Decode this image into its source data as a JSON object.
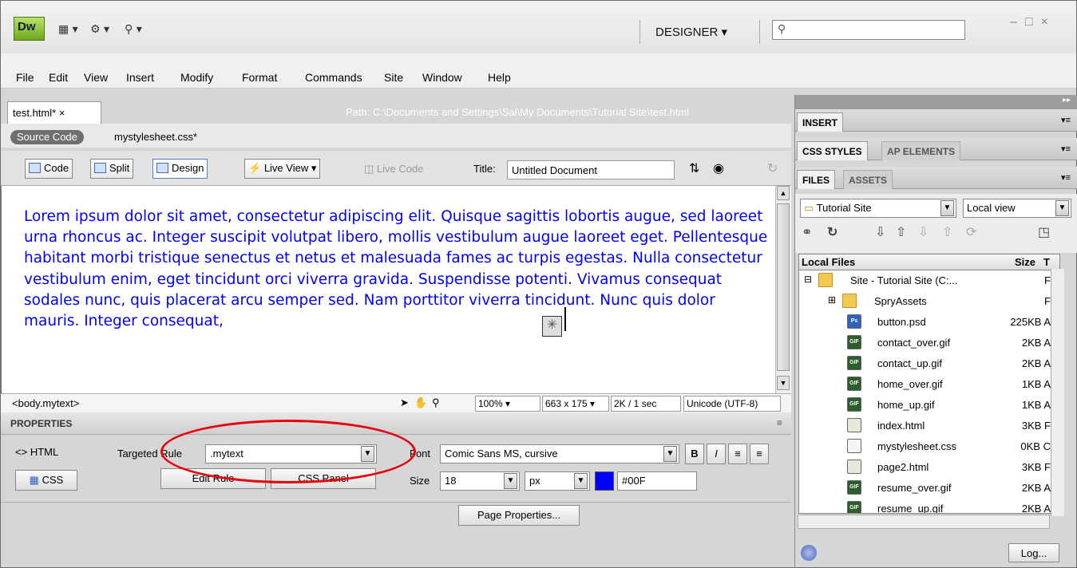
{
  "titlebar": {
    "logo": "Dw",
    "workspace": "DESIGNER",
    "search_placeholder": "",
    "icons": [
      "layout-icon",
      "gear-icon",
      "site-icon",
      "search-icon",
      "minimize-icon",
      "maximize-icon",
      "close-icon"
    ]
  },
  "menu": [
    "File",
    "Edit",
    "View",
    "Insert",
    "Modify",
    "Format",
    "Commands",
    "Site",
    "Window",
    "Help"
  ],
  "document": {
    "tab": "test.html*",
    "tab_close": "×",
    "path": "Path:  C:\\Documents and Settings\\Sal\\My Documents\\Tutorial Site\\test.html",
    "source_code": "Source Code",
    "related_file": "mystylesheet.css*",
    "view_buttons": [
      "Code",
      "Split",
      "Design"
    ],
    "live_view": "Live View",
    "live_code": "Live Code",
    "title_label": "Title:",
    "title_value": "Untitled Document",
    "body_text": "Lorem ipsum dolor sit amet, consectetur adipiscing elit. Quisque sagittis lobortis augue, sed laoreet urna rhoncus ac. Integer suscipit volutpat libero, mollis vestibulum augue laoreet eget. Pellentesque habitant morbi tristique senectus et netus et malesuada fames ac turpis egestas. Nulla consectetur vestibulum enim, eget tincidunt orci viverra gravida. Suspendisse potenti. Vivamus consequat sodales nunc, quis placerat arcu semper sed. Nam porttitor viverra tincidunt. Nunc quis dolor mauris. Integer consequat,"
  },
  "status": {
    "tag": "<body.mytext>",
    "zoom": "100%",
    "dimensions": "663 x 175",
    "download": "2K / 1 sec",
    "encoding": "Unicode (UTF-8)"
  },
  "properties": {
    "title": "PROPERTIES",
    "html_btn": "HTML",
    "css_btn": "CSS",
    "targeted_rule_label": "Targeted Rule",
    "targeted_rule": ".mytext",
    "edit_rule": "Edit Rule",
    "css_panel": "CSS Panel",
    "font_label": "Font",
    "font_value": "Comic Sans MS, cursive",
    "size_label": "Size",
    "size_value": "18",
    "unit_value": "px",
    "color_value": "#00F",
    "color_swatch": "#0000ff",
    "page_properties": "Page Properties..."
  },
  "panels": {
    "insert": "INSERT",
    "css_styles": "CSS STYLES",
    "ap_elements": "AP ELEMENTS",
    "files": "FILES",
    "assets": "ASSETS",
    "site_select": "Tutorial Site",
    "view_select": "Local view",
    "col_local": "Local Files",
    "col_size": "Size",
    "col_type": "T",
    "log": "Log...",
    "files_list": [
      {
        "name": "Site - Tutorial Site (C:...",
        "size": "",
        "type": "F",
        "kind": "folder"
      },
      {
        "name": "SpryAssets",
        "size": "",
        "type": "F",
        "kind": "folder"
      },
      {
        "name": "button.psd",
        "size": "225KB",
        "type": "A",
        "kind": "psd"
      },
      {
        "name": "contact_over.gif",
        "size": "2KB",
        "type": "A",
        "kind": "gif"
      },
      {
        "name": "contact_up.gif",
        "size": "2KB",
        "type": "A",
        "kind": "gif"
      },
      {
        "name": "home_over.gif",
        "size": "1KB",
        "type": "A",
        "kind": "gif"
      },
      {
        "name": "home_up.gif",
        "size": "1KB",
        "type": "A",
        "kind": "gif"
      },
      {
        "name": "index.html",
        "size": "3KB",
        "type": "F",
        "kind": "html"
      },
      {
        "name": "mystylesheet.css",
        "size": "0KB",
        "type": "C",
        "kind": "css"
      },
      {
        "name": "page2.html",
        "size": "3KB",
        "type": "F",
        "kind": "html"
      },
      {
        "name": "resume_over.gif",
        "size": "2KB",
        "type": "A",
        "kind": "gif"
      },
      {
        "name": "resume_up.gif",
        "size": "2KB",
        "type": "A",
        "kind": "gif"
      }
    ]
  }
}
